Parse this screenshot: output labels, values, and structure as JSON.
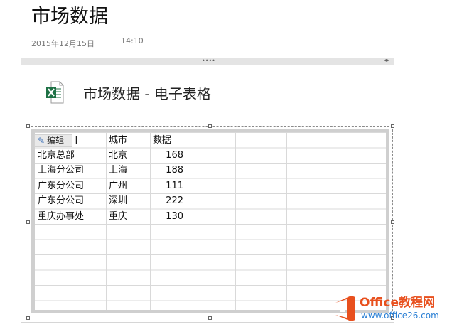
{
  "page": {
    "title": "市场数据",
    "date": "2015年12月15日",
    "time": "14:10"
  },
  "embed": {
    "title": "市场数据 - 电子表格",
    "file_icon": "excel-file-icon",
    "grip": "••••",
    "expand": "◂▸"
  },
  "sheet": {
    "edit_label": "编辑",
    "edit_icon": "pencil-icon",
    "first_header_tail": "]",
    "headers": [
      "城市",
      "数据"
    ],
    "rows": [
      {
        "dept": "北京总部",
        "city": "北京",
        "value": "168"
      },
      {
        "dept": "上海分公司",
        "city": "上海",
        "value": "188"
      },
      {
        "dept": "广东分公司",
        "city": "广州",
        "value": "111"
      },
      {
        "dept": "广东分公司",
        "city": "深圳",
        "value": "222"
      },
      {
        "dept": "重庆办事处",
        "city": "重庆",
        "value": "130"
      }
    ]
  },
  "watermark": {
    "brand": "Office教程网",
    "url": "www.office26.com",
    "brand_color": "#e8501e",
    "url_color": "#2a7fd4"
  }
}
